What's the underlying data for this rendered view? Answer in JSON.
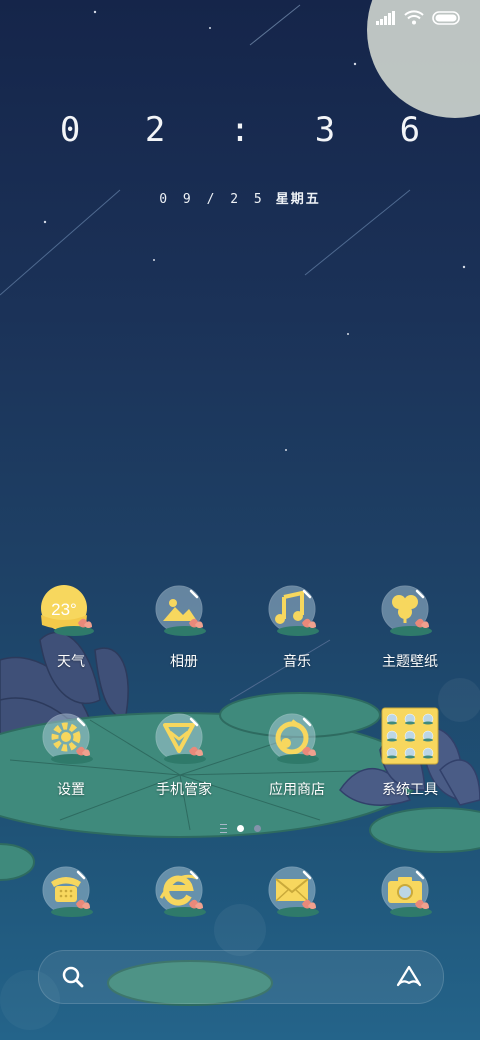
{
  "status_bar": {
    "icons": [
      "signal-icon",
      "wifi-icon",
      "battery-icon"
    ]
  },
  "lock": {
    "time": "0 2 : 3 6",
    "date": "0 9 / 2 5",
    "weekday": "星期五"
  },
  "rows": [
    [
      {
        "label": "天气",
        "icon": "weather-icon",
        "temp": "23°"
      },
      {
        "label": "相册",
        "icon": "gallery-icon"
      },
      {
        "label": "音乐",
        "icon": "music-icon"
      },
      {
        "label": "主题壁纸",
        "icon": "themes-icon"
      }
    ],
    [
      {
        "label": "设置",
        "icon": "settings-icon"
      },
      {
        "label": "手机管家",
        "icon": "security-icon"
      },
      {
        "label": "应用商店",
        "icon": "app-store-icon"
      },
      {
        "label": "系统工具",
        "icon": "system-tools-folder-icon"
      }
    ]
  ],
  "dock": [
    {
      "icon": "phone-icon"
    },
    {
      "icon": "browser-icon"
    },
    {
      "icon": "messages-icon"
    },
    {
      "icon": "camera-icon"
    }
  ],
  "pages": {
    "count": 2,
    "current": 1
  },
  "search_bar": {
    "left_icon": "search-icon",
    "right_icon": "assistant-icon"
  },
  "colors": {
    "icon_yellow": "#f7d75e",
    "bubble": "#bcd6e6",
    "leaf": "#3f8a7c",
    "lotus": "#4a5c86",
    "accent_text": "#ffffff"
  }
}
